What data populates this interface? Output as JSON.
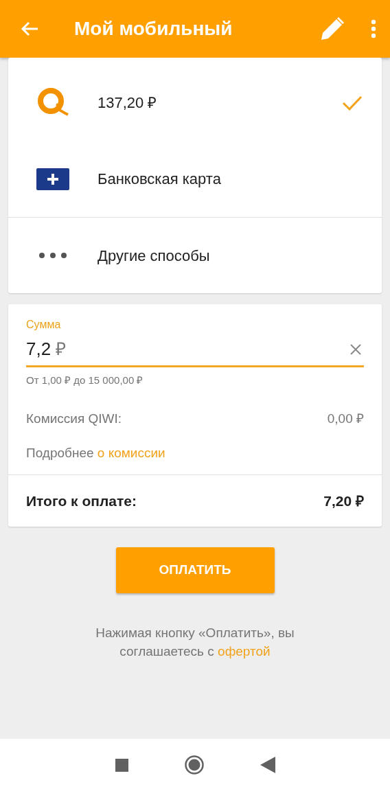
{
  "app_bar": {
    "title": "Мой мобильный"
  },
  "payment_methods": [
    {
      "kind": "wallet",
      "label": "137,20 ₽",
      "selected": true
    },
    {
      "kind": "card",
      "label": "Банковская карта",
      "selected": false
    },
    {
      "kind": "other",
      "label": "Другие способы",
      "selected": false
    }
  ],
  "amount": {
    "label": "Сумма",
    "value": "7,2",
    "currency": "₽",
    "hint": "От 1,00 ₽ до 15 000,00 ₽"
  },
  "commission": {
    "label": "Комиссия QIWI:",
    "value": "0,00 ₽"
  },
  "details": {
    "text": "Подробнее",
    "link": "о комиссии"
  },
  "total": {
    "label": "Итого к оплате:",
    "value": "7,20 ₽"
  },
  "pay_button": {
    "label": "ОПЛАТИТЬ"
  },
  "terms": {
    "text": "Нажимая кнопку «Оплатить», вы соглашаетесь с",
    "link": "офертой"
  }
}
